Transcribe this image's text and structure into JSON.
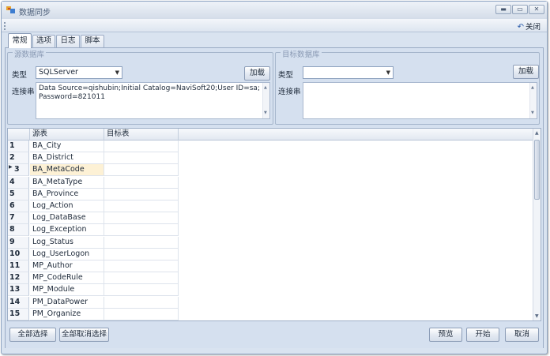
{
  "window": {
    "title": "数据同步",
    "controls": {
      "minimize": "▬",
      "maximize": "▭",
      "close": "✕"
    }
  },
  "toolbar": {
    "close_label": "关闭",
    "close_icon": "undo-arrow-icon"
  },
  "tabs": [
    {
      "label": "常规",
      "active": true
    },
    {
      "label": "选项",
      "active": false
    },
    {
      "label": "日志",
      "active": false
    },
    {
      "label": "脚本",
      "active": false
    }
  ],
  "source": {
    "group_title": "源数据库",
    "type_label": "类型",
    "type_value": "SQLServer",
    "load_button": "加载",
    "conn_label": "连接串",
    "conn_value": "Data Source=qishubin;Initial Catalog=NaviSoft20;User ID=sa;Password=821011"
  },
  "target": {
    "group_title": "目标数据库",
    "type_label": "类型",
    "type_value": "",
    "load_button": "加载",
    "conn_label": "连接串",
    "conn_value": ""
  },
  "grid": {
    "columns": [
      "源表",
      "目标表"
    ],
    "selected_row": 3,
    "rows": [
      {
        "num": "1",
        "source": "BA_City",
        "target": ""
      },
      {
        "num": "2",
        "source": "BA_District",
        "target": ""
      },
      {
        "num": "3",
        "source": "BA_MetaCode",
        "target": ""
      },
      {
        "num": "4",
        "source": "BA_MetaType",
        "target": ""
      },
      {
        "num": "5",
        "source": "BA_Province",
        "target": ""
      },
      {
        "num": "6",
        "source": "Log_Action",
        "target": ""
      },
      {
        "num": "7",
        "source": "Log_DataBase",
        "target": ""
      },
      {
        "num": "8",
        "source": "Log_Exception",
        "target": ""
      },
      {
        "num": "9",
        "source": "Log_Status",
        "target": ""
      },
      {
        "num": "10",
        "source": "Log_UserLogon",
        "target": ""
      },
      {
        "num": "11",
        "source": "MP_Author",
        "target": ""
      },
      {
        "num": "12",
        "source": "MP_CodeRule",
        "target": ""
      },
      {
        "num": "13",
        "source": "MP_Module",
        "target": ""
      },
      {
        "num": "14",
        "source": "PM_DataPower",
        "target": ""
      },
      {
        "num": "15",
        "source": "PM_Organize",
        "target": ""
      }
    ]
  },
  "footer": {
    "select_all": "全部选择",
    "deselect_all": "全部取消选择",
    "preview": "预览",
    "start": "开始",
    "cancel": "取消"
  },
  "colors": {
    "window_bg": "#d9e3f0",
    "panel_bg": "#d5e0ef",
    "selection": "#fdf1d5",
    "accent": "#2a5aa8"
  }
}
